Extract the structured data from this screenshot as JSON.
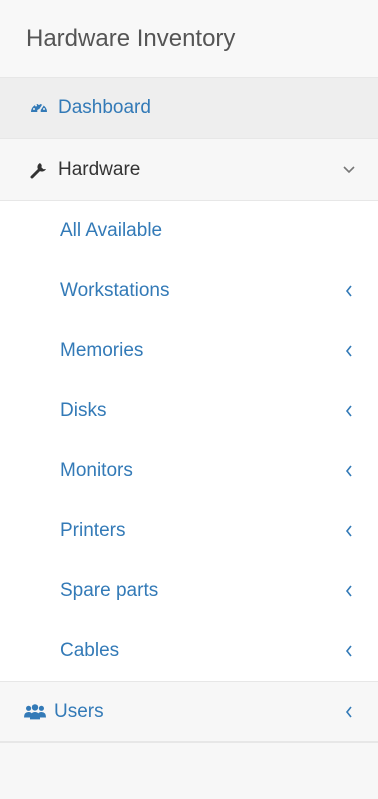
{
  "sidebar": {
    "brand": "Hardware Inventory",
    "dashboard": {
      "label": "Dashboard",
      "icon": "dashboard-gauge-icon"
    },
    "hardware": {
      "label": "Hardware",
      "icon": "wrench-icon",
      "expanded": true,
      "children": [
        {
          "label": "All Available",
          "has_submenu": false
        },
        {
          "label": "Workstations",
          "has_submenu": true
        },
        {
          "label": "Memories",
          "has_submenu": true
        },
        {
          "label": "Disks",
          "has_submenu": true
        },
        {
          "label": "Monitors",
          "has_submenu": true
        },
        {
          "label": "Printers",
          "has_submenu": true
        },
        {
          "label": "Spare parts",
          "has_submenu": true
        },
        {
          "label": "Cables",
          "has_submenu": true
        }
      ]
    },
    "users": {
      "label": "Users",
      "icon": "users-icon"
    }
  },
  "colors": {
    "link": "#337ab7",
    "text": "#333333",
    "brand_text": "#555555",
    "active_bg": "#eeeeee"
  }
}
